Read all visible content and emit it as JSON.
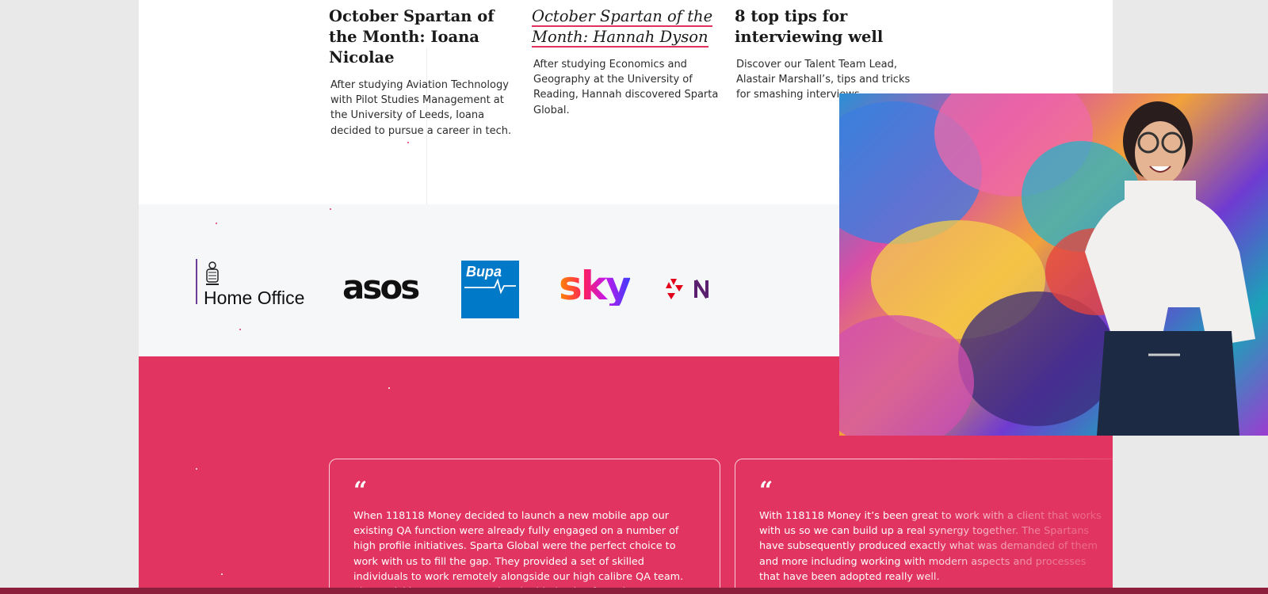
{
  "articles": [
    {
      "title": "October Spartan of the Month: Ioana Nicolae",
      "excerpt": "After studying Aviation Technology with Pilot Studies Management at the University of Leeds, Ioana decided to pursue a career in tech."
    },
    {
      "title": "October Spartan of the Month: Hannah Dyson",
      "excerpt": "After studying Economics and Geography at the University of Reading, Hannah discovered Sparta Global."
    },
    {
      "title": "8 top tips for interviewing well",
      "excerpt": "Discover our Talent Team Lead, Alastair Marshall’s, tips and tricks for smashing interviews."
    }
  ],
  "clients": {
    "home_office": "Home Office",
    "asos": "asos",
    "bupa": "Bupa",
    "sky": "sky",
    "natwest": "N"
  },
  "testimonials": [
    {
      "mark": "“",
      "text": "When 118118 Money decided to launch a new mobile app our existing QA function were already fully engaged on a number of high profile initiatives. Sparta Global were the perfect choice to work with us to fill the gap. They provided a set of skilled individuals to work remotely alongside our high calibre QA team. They quickly got up to speed and added value from day one. An excellent engagement which we have since extended on other"
    },
    {
      "mark": "“",
      "text": "With 118118 Money it’s been great to work with a client that works with us so we can build up a real synergy together. The Spartans have subsequently produced exactly what was demanded of them and more including working with modern aspects and processes that have been adopted really well."
    }
  ],
  "colors": {
    "accent": "#e23460",
    "home_office_purple": "#6f3c96",
    "bupa_blue": "#0079c8",
    "natwest_red": "#e2001a"
  },
  "photo": {
    "icon": "woman-photo"
  }
}
